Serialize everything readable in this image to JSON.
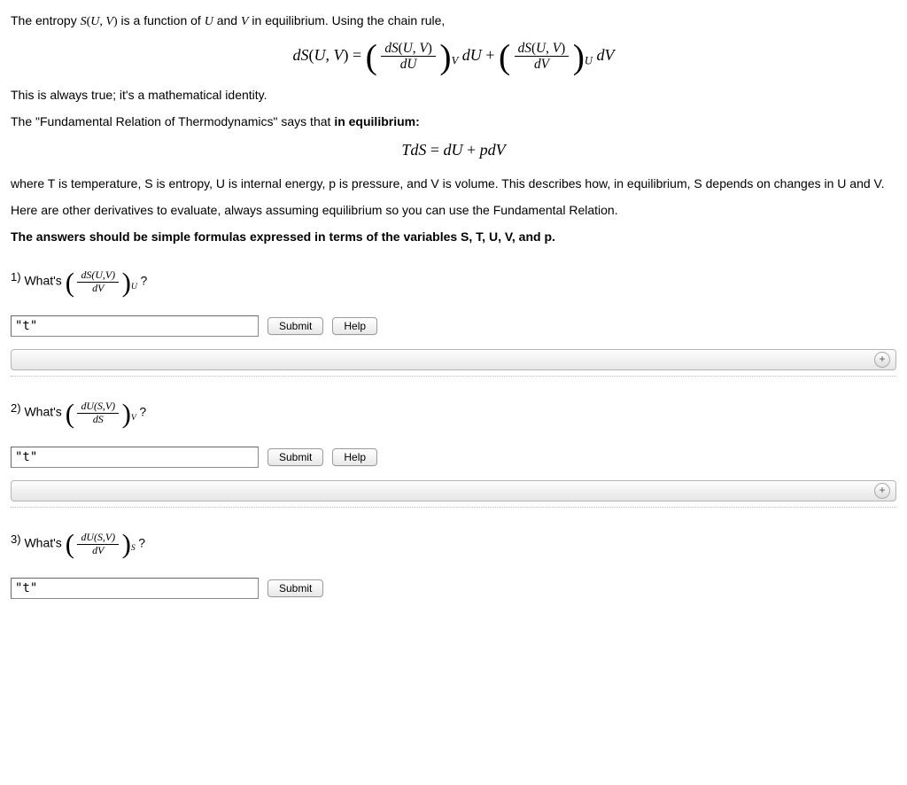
{
  "intro": {
    "p1_a": "The entropy ",
    "p1_b": " is a function of ",
    "p1_c": " and ",
    "p1_d": " in equilibrium. Using the chain rule,",
    "eq1": "dS(U, V) = ( dS(U,V)/dU )_V dU + ( dS(U,V)/dV )_U dV",
    "p2": "This is always true; it's a mathematical identity.",
    "p3_a": "The \"Fundamental Relation of Thermodynamics\" says that ",
    "p3_b": "in equilibrium:",
    "eq2": "TdS = dU + pdV",
    "p4": "where T is temperature, S is entropy, U is internal energy, p is pressure, and V is volume. This describes how, in equilibrium, S depends on changes in U and V.",
    "p5": "Here are other derivatives to evaluate, always assuming equilibrium so you can use the Fundamental Relation.",
    "p6": "The answers should be simple formulas expressed in terms of the variables S, T, U, V, and p."
  },
  "questions": [
    {
      "num": "1)",
      "prompt": "What's",
      "deriv_num": "dS(U,V)",
      "deriv_den": "dV",
      "deriv_sub": "U",
      "suffix": "?",
      "value": "\"t\""
    },
    {
      "num": "2)",
      "prompt": "What's",
      "deriv_num": "dU(S,V)",
      "deriv_den": "dS",
      "deriv_sub": "V",
      "suffix": "?",
      "value": "\"t\""
    },
    {
      "num": "3)",
      "prompt": "What's",
      "deriv_num": "dU(S,V)",
      "deriv_den": "dV",
      "deriv_sub": "S",
      "suffix": "?",
      "value": "\"t\""
    }
  ],
  "buttons": {
    "submit": "Submit",
    "help": "Help"
  },
  "icons": {
    "plus": "+"
  }
}
